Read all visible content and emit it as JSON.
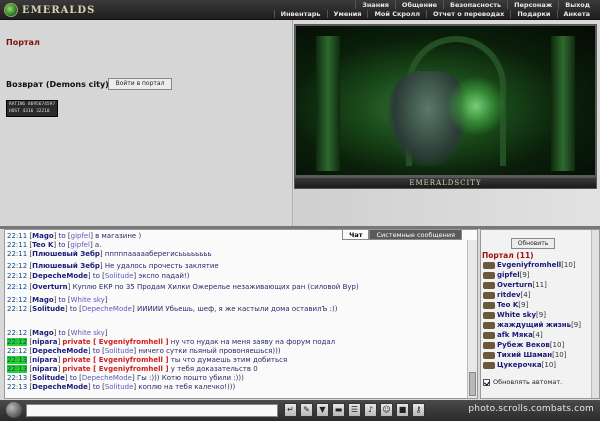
{
  "header": {
    "logo_text": "EMERALDS",
    "menu_top": [
      "Знания",
      "Общение",
      "Безопасность",
      "Персонаж",
      "Выход"
    ],
    "menu_bottom": [
      "Инвентарь",
      "Умения",
      "Мой Скролл",
      "Отчет о переводах",
      "Подарки",
      "Анкета"
    ]
  },
  "location": {
    "title": "Портал",
    "return_label": "Возврат (Demons city)",
    "portal_button": "Войти в портал",
    "counter_line1": "RATING 8695674597",
    "counter_line2": "HOST 4316 32218",
    "scene_caption": "EMERALDSCITY"
  },
  "chat": {
    "tabs": [
      "Чат",
      "Системные сообщения"
    ],
    "lines": [
      {
        "time": "22:11",
        "nick": "Mago",
        "to": "to",
        "target": "gipfel",
        "msg": "в магазине )",
        "private": false
      },
      {
        "time": "22:11",
        "nick": "Teo K",
        "to": "to",
        "target": "gipfel",
        "msg": "а.",
        "private": false
      },
      {
        "time": "22:11",
        "nick": "Плюшевый Зебр",
        "to": "",
        "target": "",
        "msg": "пппппаааааберегисьььььььь",
        "private": false
      },
      {
        "time": "22:12",
        "nick": "Плюшевый Зебр",
        "to": "",
        "target": "",
        "msg": "Не удалось прочесть заклятие",
        "private": false
      },
      {
        "time": "22:12",
        "nick": "DepecheMode",
        "to": "to",
        "target": "Solitude",
        "msg": "экспо падай!)",
        "private": false
      },
      {
        "time": "22:12",
        "nick": "Overturn",
        "to": "",
        "target": "",
        "msg": "Куплю ЕКР по 35    Продам Хилки    Ожерелье незаживающих ран (силовой Вур)",
        "private": false
      },
      {
        "time": "22:12",
        "nick": "Mago",
        "to": "to",
        "target": "White sky",
        "msg": "",
        "private": false
      },
      {
        "time": "22:12",
        "nick": "Solitude",
        "to": "to",
        "target": "DepecheMode",
        "msg": "ИИИИИ Убьешь, шеф, я же кастыли дома оставилЪ :))",
        "private": false
      },
      {
        "time": "22:12",
        "nick": "Mago",
        "to": "to",
        "target": "White sky",
        "msg": "",
        "private": false
      },
      {
        "time": "22:12",
        "nick": "nipara",
        "to": "",
        "target": "",
        "msg": "ну что нудак на меня заяву на форум подал",
        "private": true,
        "private_label": "private [ Evgeniyfromhell ]"
      },
      {
        "time": "22:12",
        "nick": "DepecheMode",
        "to": "to",
        "target": "Solitude",
        "msg": "ничего сутки пьяный провоняешься)))",
        "private": false
      },
      {
        "time": "22:13",
        "nick": "nipara",
        "to": "",
        "target": "",
        "msg": "ты что думаешь этим добиться",
        "private": true,
        "private_label": "private [ Evgeniyfromhell ]"
      },
      {
        "time": "22:13",
        "nick": "nipara",
        "to": "",
        "target": "",
        "msg": "у тебя доказательств 0",
        "private": true,
        "private_label": "private [ Evgeniyfromhell ]"
      },
      {
        "time": "22:13",
        "nick": "Solitude",
        "to": "to",
        "target": "DepecheMode",
        "msg": "Гы :))) Котю пошто убили :)))",
        "private": false
      },
      {
        "time": "22:13",
        "nick": "DepecheMode",
        "to": "to",
        "target": "Solitude",
        "msg": "коплю на тебя калечко!)))",
        "private": false
      }
    ]
  },
  "users": {
    "refresh_button": "Обновить",
    "title": "Портал (11)",
    "list": [
      {
        "name": "Evgeniyfromhell",
        "level": "[10]"
      },
      {
        "name": "gipfel",
        "level": "[9]"
      },
      {
        "name": "Overturn",
        "level": "[11]"
      },
      {
        "name": "ritdev",
        "level": "[4]"
      },
      {
        "name": "Teo K",
        "level": "[9]"
      },
      {
        "name": "White sky",
        "level": "[9]"
      },
      {
        "name": "жаждущий жизнь",
        "level": "[9]"
      },
      {
        "name": "afk Мяка",
        "level": "[4]"
      },
      {
        "name": "Рубеж Веков",
        "level": "[10]"
      },
      {
        "name": "Тихий Шаман",
        "level": "[10]"
      },
      {
        "name": "Цукерочка",
        "level": "[10]"
      }
    ],
    "auto_refresh": "Обновлять автомат."
  },
  "bottombar": {
    "input_value": "",
    "watermark": "photo.scrolls.combats.com"
  }
}
